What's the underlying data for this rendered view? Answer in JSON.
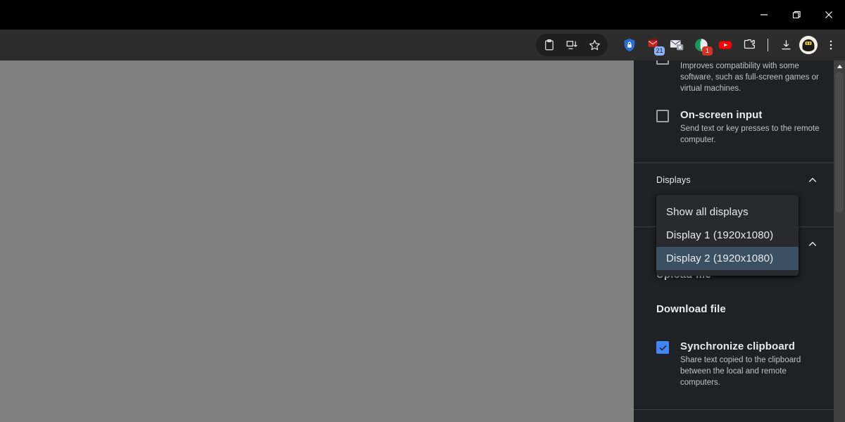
{
  "window": {
    "controls": [
      {
        "name": "minimize",
        "glyph": "minimize-icon"
      },
      {
        "name": "maximize",
        "glyph": "restore-icon"
      },
      {
        "name": "close",
        "glyph": "close-icon"
      }
    ]
  },
  "toolbar": {
    "pill_icons": [
      {
        "name": "clipboard-icon",
        "label": "Copy link"
      },
      {
        "name": "cast-icon",
        "label": "Save and share"
      },
      {
        "name": "star-icon",
        "label": "Bookmark this tab"
      }
    ],
    "extensions": [
      {
        "name": "shield-lock-icon",
        "label": "Password manager",
        "badge": "",
        "badge_color": ""
      },
      {
        "name": "mail-stack-icon",
        "label": "Mail",
        "badge": "21",
        "badge_color": "#8ab4f8"
      },
      {
        "name": "envelope-x-icon",
        "label": "Spam filter",
        "badge": "",
        "badge_color": ""
      },
      {
        "name": "notes-icon",
        "label": "Notes",
        "badge": "1",
        "badge_color": "#d93025"
      },
      {
        "name": "youtube-icon",
        "label": "YouTube",
        "badge": "",
        "badge_color": ""
      },
      {
        "name": "puzzle-icon",
        "label": "Extensions",
        "badge": "",
        "badge_color": ""
      }
    ],
    "download_icon": "download-icon",
    "avatar": "account-avatar",
    "menu_icon": "three-dot-menu-icon"
  },
  "panel": {
    "partial_setting": {
      "description": "Improves compatibility with some software, such as full-screen games or virtual machines."
    },
    "onscreen_input": {
      "title": "On-screen input",
      "description": "Send text or key presses to the remote computer.",
      "checked": false
    },
    "displays_group": {
      "title": "Displays",
      "expanded": true,
      "chevron": "chevron-up-icon"
    },
    "file_transfer_group": {
      "chevron": "chevron-up-icon"
    },
    "upload_file": "Upload file",
    "download_file": "Download file",
    "sync_clipboard": {
      "title": "Synchronize clipboard",
      "description": "Share text copied to the clipboard between the local and remote computers.",
      "checked": true
    },
    "dropdown": {
      "items": [
        {
          "label": "Show all displays",
          "selected": false
        },
        {
          "label": "Display 1 (1920x1080)",
          "selected": false
        },
        {
          "label": "Display 2 (1920x1080)",
          "selected": true
        }
      ]
    }
  },
  "colors": {
    "panel_bg": "#202124",
    "menu_bg": "#292a2d",
    "selected_bg": "#3b5063",
    "accent": "#4285f4",
    "viewport": "#808080",
    "toolbar_bg": "#2c2c2c"
  }
}
